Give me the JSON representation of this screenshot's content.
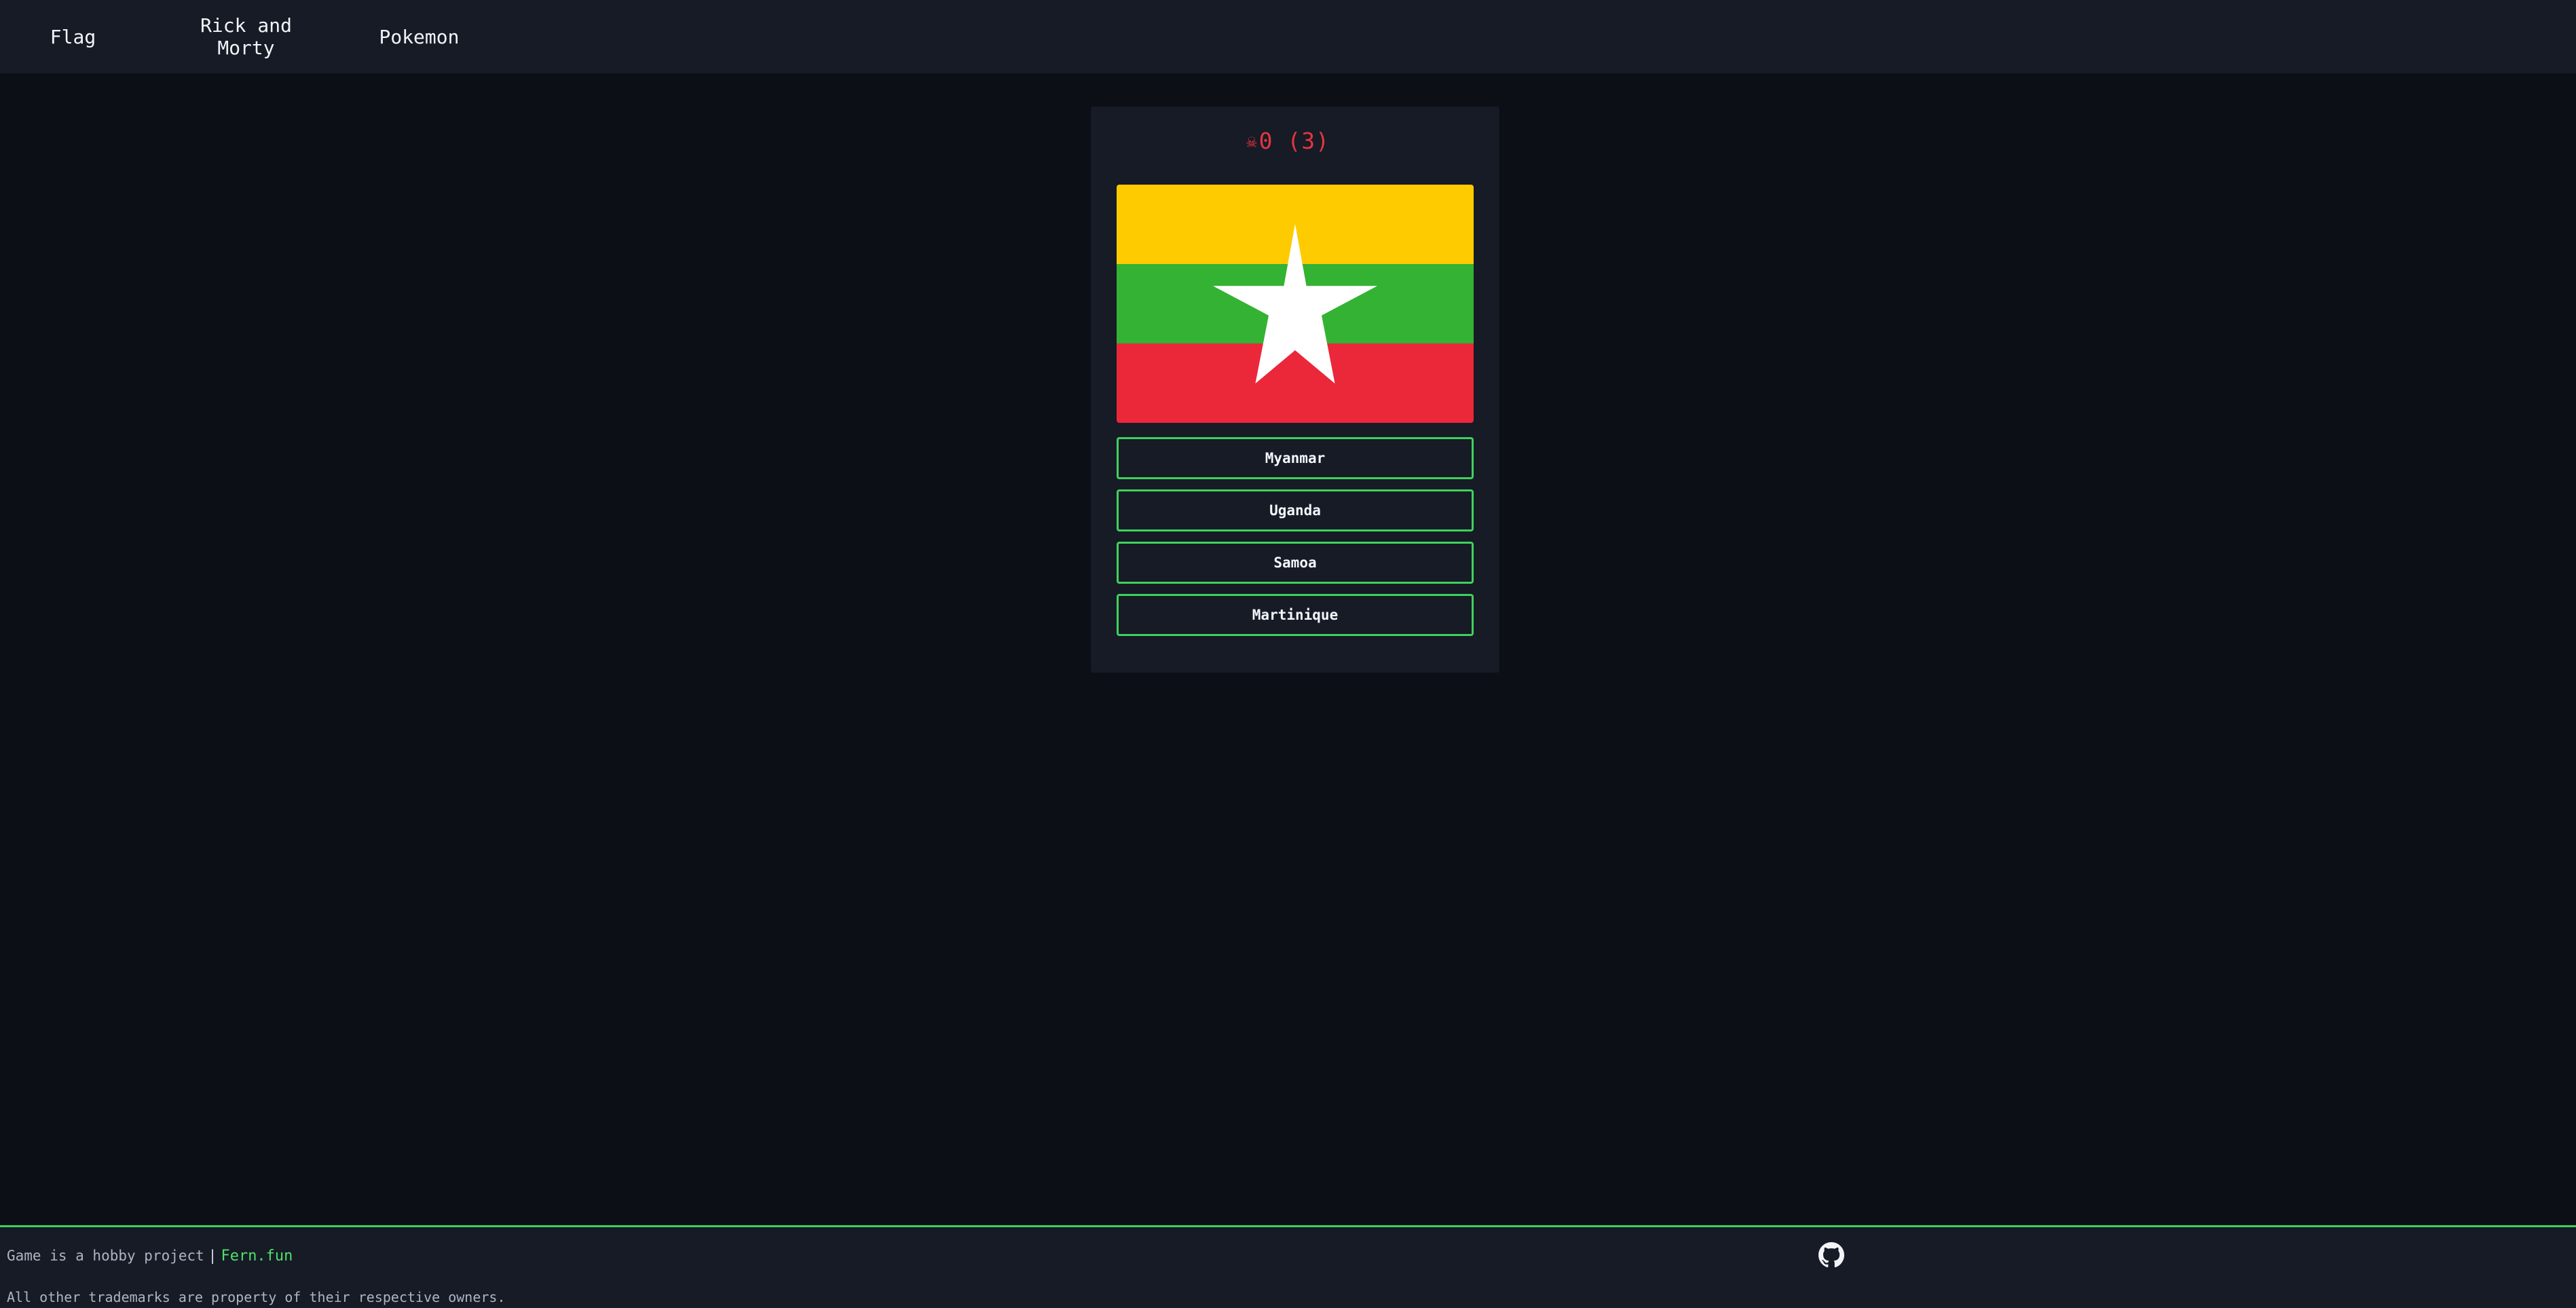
{
  "nav": {
    "items": [
      {
        "label": "Flag"
      },
      {
        "label": "Rick and Morty"
      },
      {
        "label": "Pokemon"
      }
    ]
  },
  "game": {
    "skull_icon": "skull-icon",
    "score_text": "0 (3)",
    "flag": {
      "country": "Myanmar",
      "colors": {
        "top": "#FECB00",
        "middle": "#34B233",
        "bottom": "#EA2839",
        "star": "#FFFFFF"
      }
    },
    "options": [
      {
        "label": "Myanmar"
      },
      {
        "label": "Uganda"
      },
      {
        "label": "Samoa"
      },
      {
        "label": "Martinique"
      }
    ]
  },
  "footer": {
    "hobby_text": "Game is a hobby project",
    "separator": "|",
    "link_text": "Fern.fun",
    "trademark_text": "All other trademarks are property of their respective owners.",
    "github_icon": "github-icon"
  },
  "colors": {
    "accent": "#3fd15b",
    "score": "#e5353f",
    "background": "#0c0f16",
    "panel": "#161b26"
  }
}
